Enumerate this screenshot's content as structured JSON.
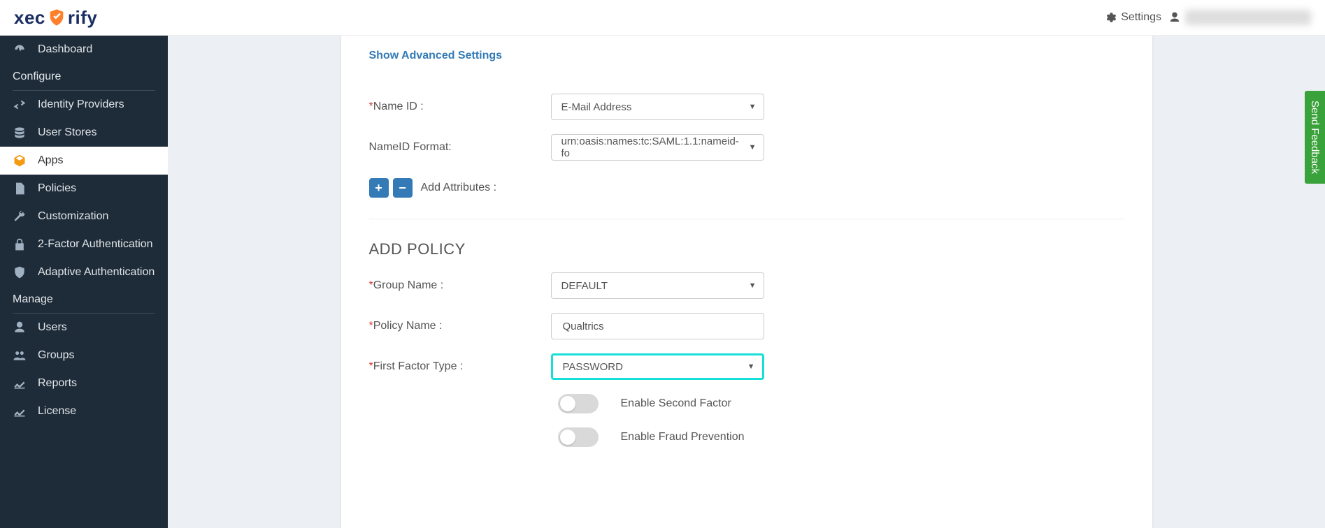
{
  "brand": {
    "pre": "xec",
    "post": "rify"
  },
  "topbar": {
    "settings_label": "Settings"
  },
  "sidebar": {
    "items": [
      {
        "label": "Dashboard",
        "icon": "dashboard-icon"
      },
      {
        "label": "Configure",
        "section": true
      },
      {
        "label": "Identity Providers",
        "icon": "exchange-icon"
      },
      {
        "label": "User Stores",
        "icon": "database-icon"
      },
      {
        "label": "Apps",
        "icon": "cube-icon",
        "active": true
      },
      {
        "label": "Policies",
        "icon": "document-icon"
      },
      {
        "label": "Customization",
        "icon": "wrench-icon"
      },
      {
        "label": "2-Factor Authentication",
        "icon": "lock-icon"
      },
      {
        "label": "Adaptive Authentication",
        "icon": "shield-icon"
      },
      {
        "label": "Manage",
        "section": true
      },
      {
        "label": "Users",
        "icon": "user-icon"
      },
      {
        "label": "Groups",
        "icon": "group-icon"
      },
      {
        "label": "Reports",
        "icon": "chart-icon"
      },
      {
        "label": "License",
        "icon": "chart-icon"
      }
    ]
  },
  "form": {
    "advanced_link": "Show Advanced Settings",
    "name_id_label": "Name ID :",
    "name_id_value": "E-Mail Address",
    "name_id_format_label": "NameID Format:",
    "name_id_format_value": "urn:oasis:names:tc:SAML:1.1:nameid-fo",
    "add_attributes_label": "Add Attributes :"
  },
  "policy": {
    "header": "ADD POLICY",
    "group_name_label": "Group Name :",
    "group_name_value": "DEFAULT",
    "policy_name_label": "Policy Name :",
    "policy_name_value": "Qualtrics",
    "first_factor_label": "First Factor Type :",
    "first_factor_value": "PASSWORD",
    "enable_second_factor_label": "Enable Second Factor",
    "enable_fraud_label": "Enable Fraud Prevention"
  },
  "feedback": {
    "label": "Send Feedback"
  }
}
